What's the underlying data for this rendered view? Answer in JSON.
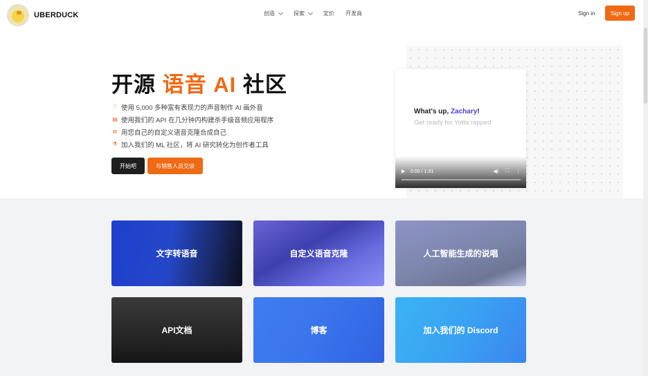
{
  "brand": {
    "name": "UBERDUCK",
    "accent": "#ef6a14"
  },
  "nav": {
    "links": [
      {
        "label": "创造",
        "dropdown": true
      },
      {
        "label": "探索",
        "dropdown": true
      },
      {
        "label": "定价",
        "dropdown": false
      },
      {
        "label": "开发商",
        "dropdown": false
      }
    ],
    "sign_in": "Sign in",
    "sign_up": "Sign up"
  },
  "hero": {
    "title_part1": "开源 ",
    "title_highlight": "语音 AI",
    "title_part2": " 社区",
    "features": [
      {
        "icon": "heart-icon",
        "text": "使用 5,000 多种富有表现力的声音制作 AI 画外音"
      },
      {
        "icon": "code-icon",
        "text": "使用我们的 API 在几分钟内构建杀手级音频应用程序"
      },
      {
        "icon": "clone-icon",
        "text": "用您自己的自定义语音克隆合成自己"
      },
      {
        "icon": "flask-icon",
        "text": "加入我们的 ML 社区，将 AI 研究转化为创作者工具"
      }
    ],
    "cta_primary": "开始吧",
    "cta_secondary": "与销售人员交谈"
  },
  "video": {
    "line1_prefix": "What's up, ",
    "line1_name": "Zachary",
    "line1_suffix": "!",
    "line2": "Get ready for Yotta rapped",
    "time": "0:00 / 1:31",
    "progress": 0
  },
  "cards": [
    {
      "label": "文字转语音"
    },
    {
      "label": "自定义语音克隆"
    },
    {
      "label": "人工智能生成的说唱"
    },
    {
      "label": "API文档"
    },
    {
      "label": "博客"
    },
    {
      "label": "加入我们的 Discord"
    }
  ]
}
